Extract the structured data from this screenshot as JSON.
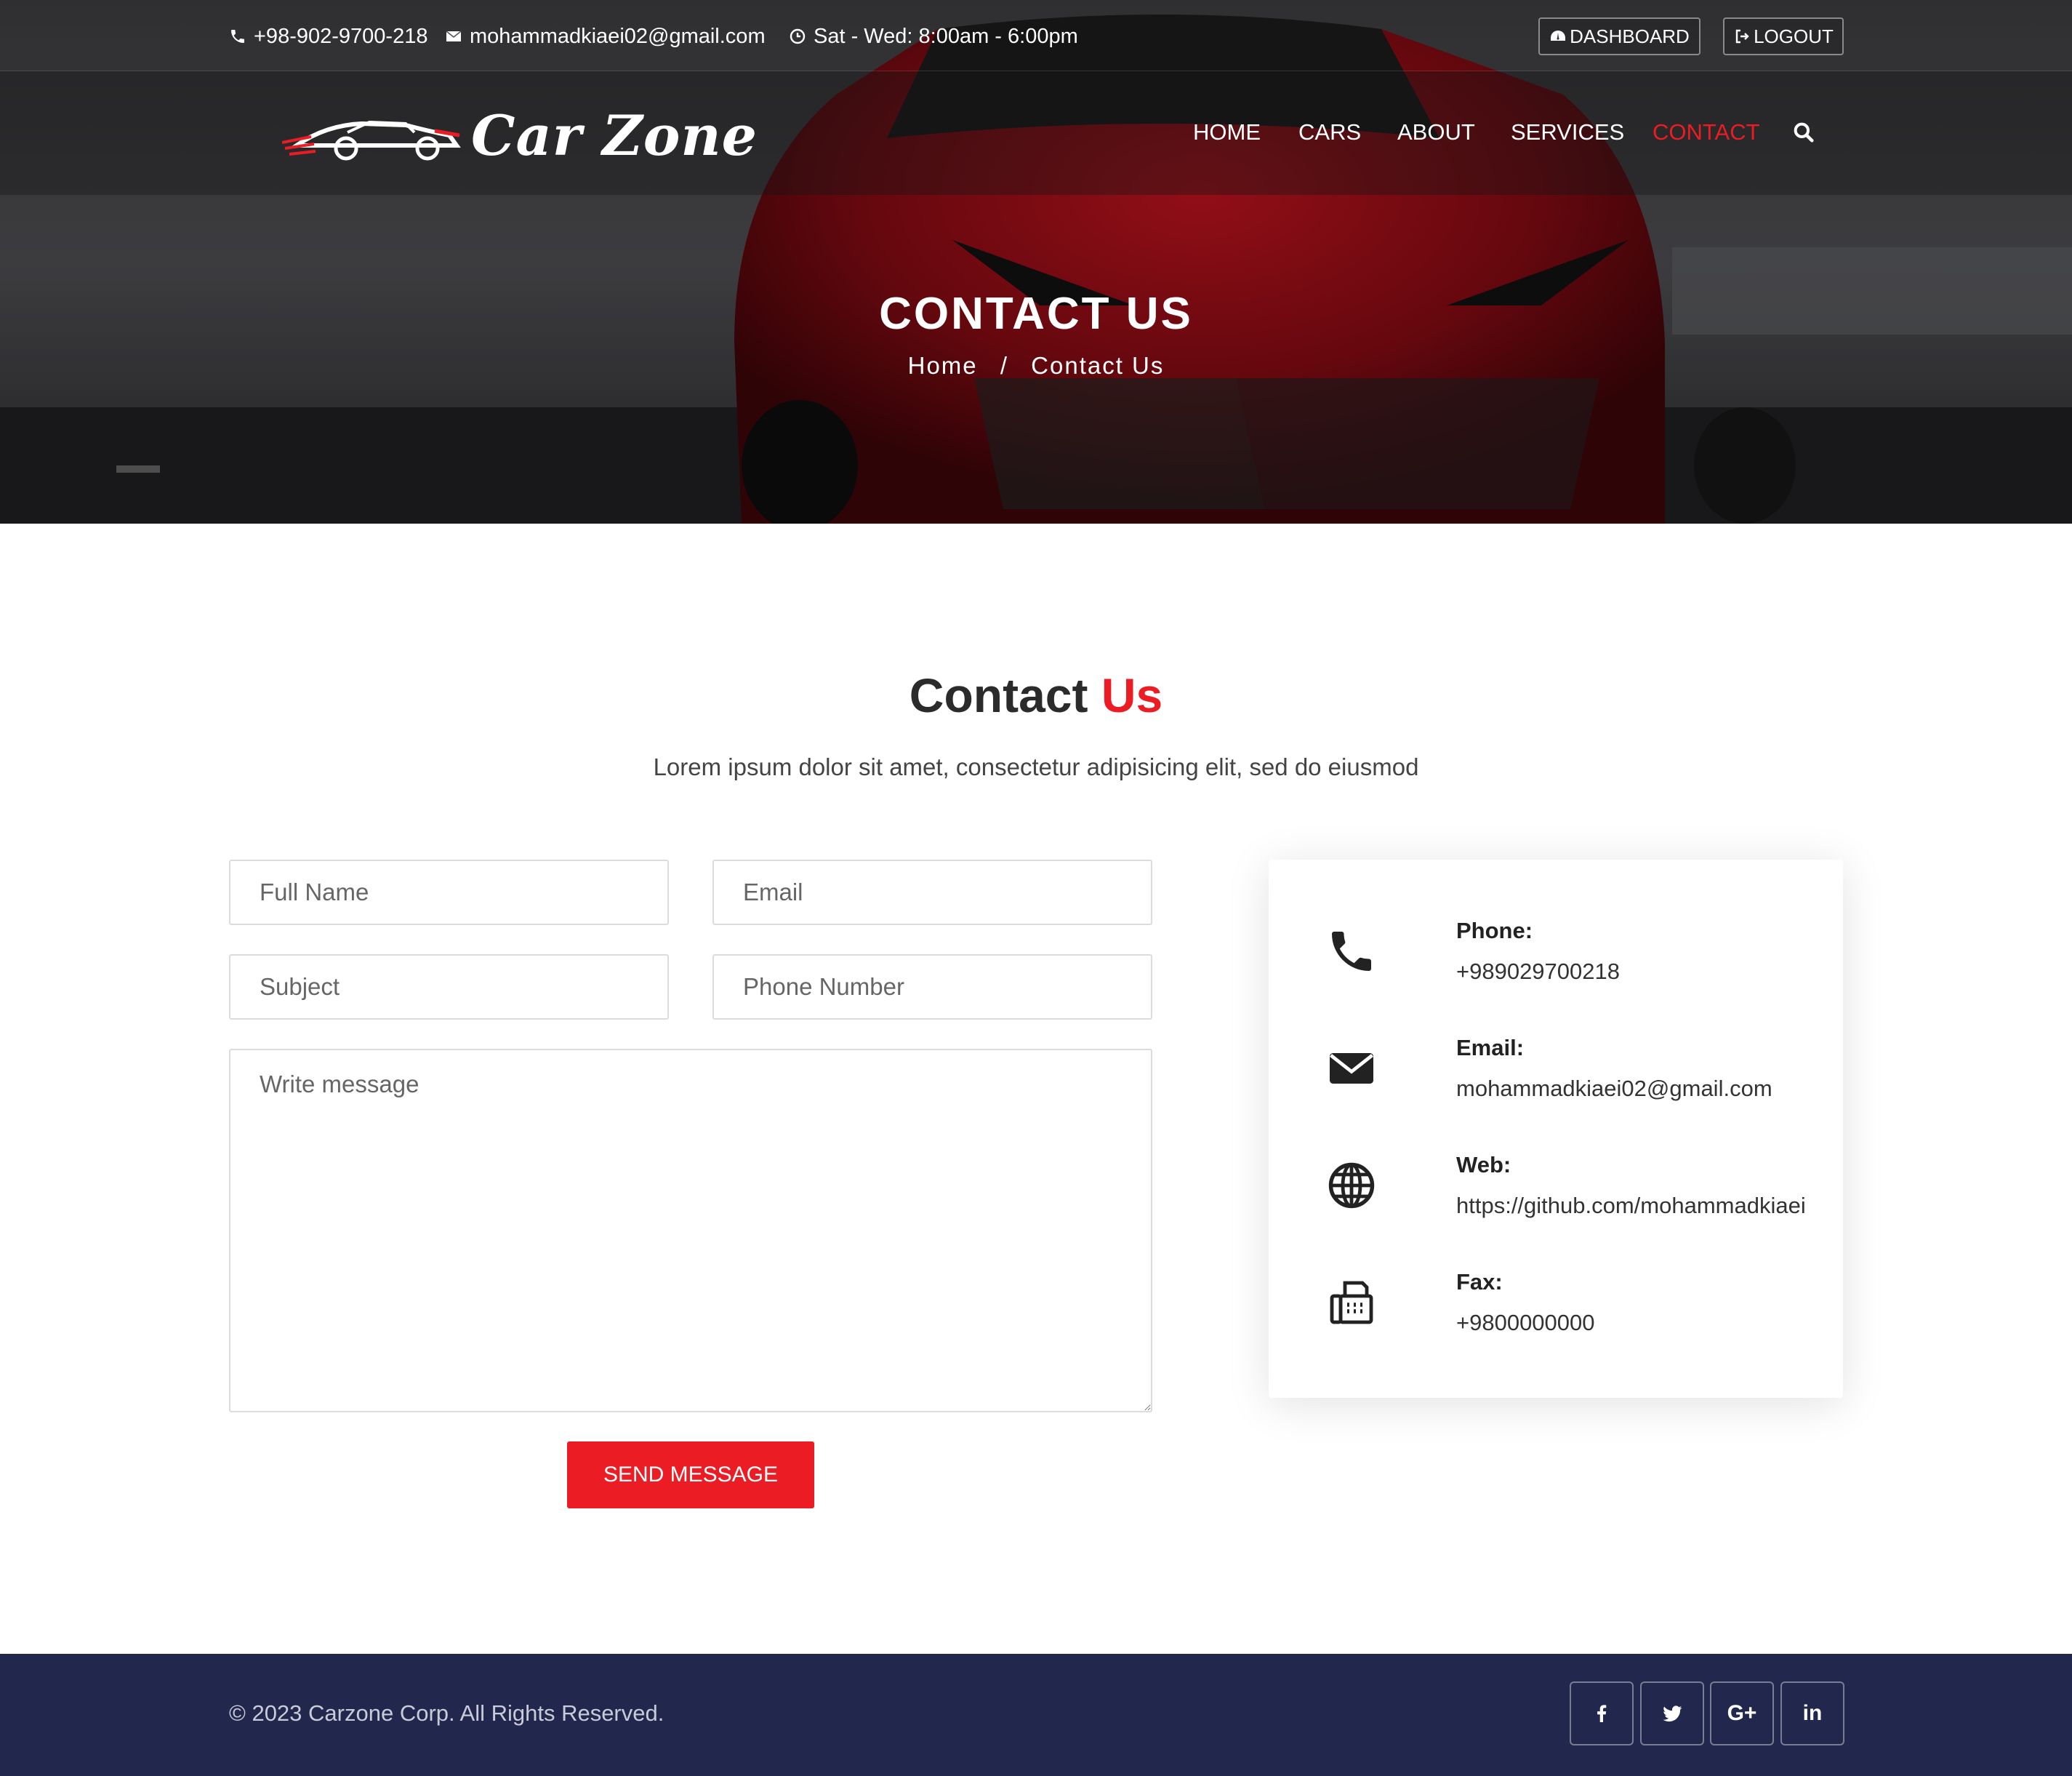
{
  "topbar": {
    "phone": "+98-902-9700-218",
    "email": "mohammadkiaei02@gmail.com",
    "hours": "Sat - Wed: 8:00am - 6:00pm",
    "dashboard_label": "DASHBOARD",
    "logout_label": "LOGOUT"
  },
  "brand": {
    "name": "Car Zone"
  },
  "nav": {
    "items": [
      {
        "label": "HOME"
      },
      {
        "label": "CARS"
      },
      {
        "label": "ABOUT"
      },
      {
        "label": "SERVICES"
      },
      {
        "label": "CONTACT"
      }
    ],
    "active": "CONTACT"
  },
  "hero": {
    "title": "CONTACT US",
    "breadcrumb": {
      "home": "Home",
      "separator": "/",
      "current": "Contact Us"
    }
  },
  "section": {
    "title_main": "Contact",
    "title_accent": "Us",
    "subtitle": "Lorem ipsum dolor sit amet, consectetur adipisicing elit, sed do eiusmod"
  },
  "form": {
    "full_name_placeholder": "Full Name",
    "email_placeholder": "Email",
    "subject_placeholder": "Subject",
    "phone_placeholder": "Phone Number",
    "message_placeholder": "Write message",
    "submit_label": "SEND MESSAGE"
  },
  "contact_info": {
    "phone_label": "Phone:",
    "phone_value": "+989029700218",
    "email_label": "Email:",
    "email_value": "mohammadkiaei02@gmail.com",
    "web_label": "Web:",
    "web_value": "https://github.com/mohammadkiaei",
    "fax_label": "Fax:",
    "fax_value": "+9800000000"
  },
  "footer": {
    "copyright": "© 2023 Carzone Corp. All Rights Reserved.",
    "social": {
      "googleplus": "G+",
      "linkedin": "in"
    }
  },
  "colors": {
    "accent": "#ec1c24",
    "footer_bg": "#21274d",
    "text_dark": "#2b2b2b"
  }
}
